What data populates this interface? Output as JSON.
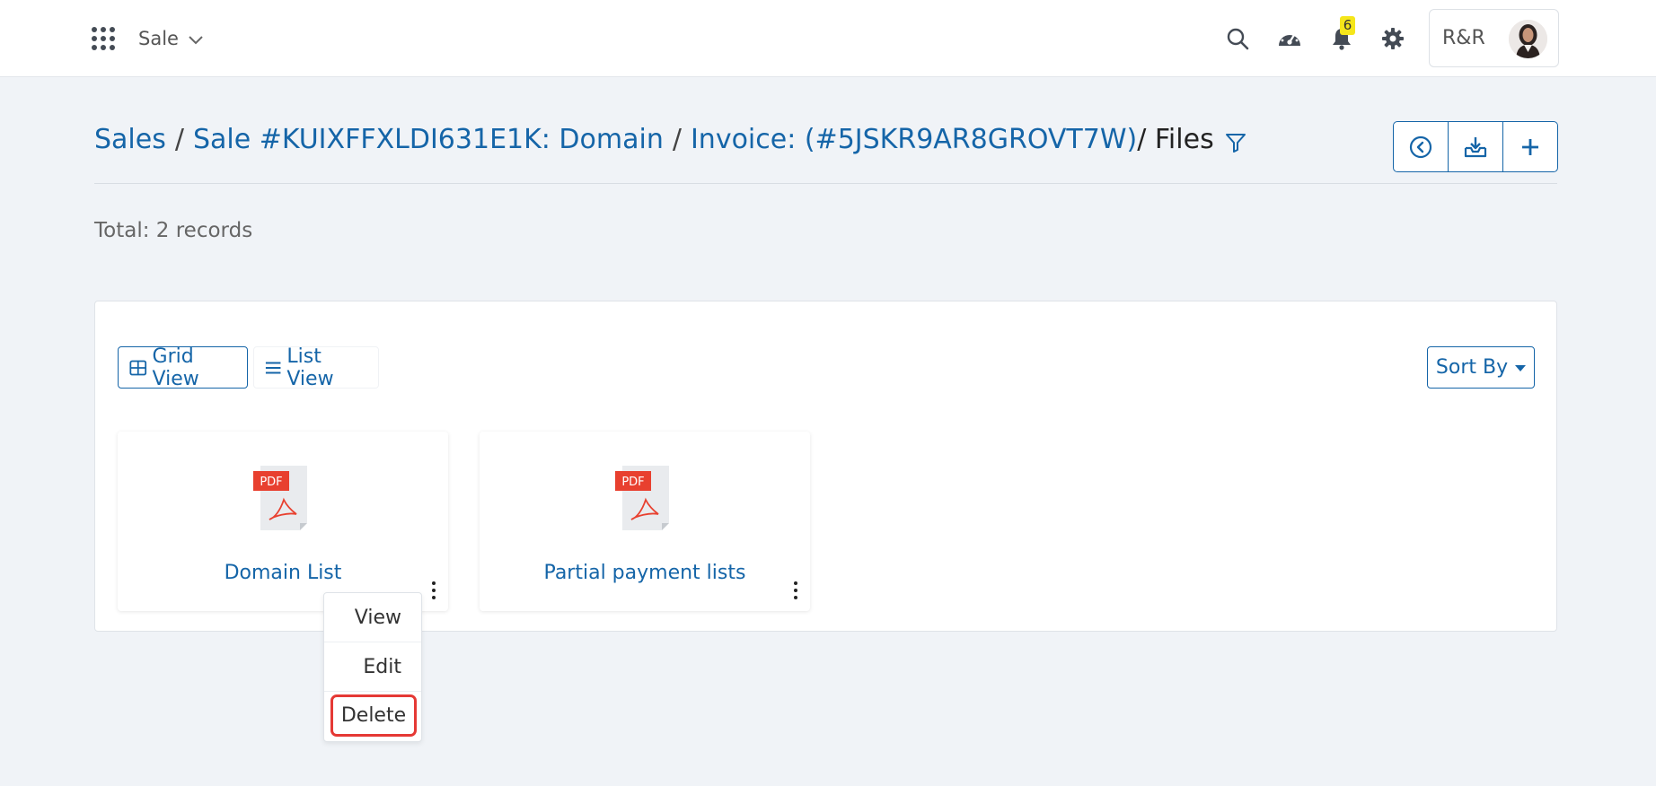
{
  "topbar": {
    "module": "Sale",
    "notification_count": "6",
    "user_name": "R&R",
    "icons": [
      "apps-grid-icon",
      "search-icon",
      "dashboard-gauge-icon",
      "bell-icon",
      "gear-icon",
      "chevron-down-icon"
    ]
  },
  "breadcrumb": {
    "sales": "Sales",
    "sep": "/",
    "sale": "Sale #KUIXFFXLDI631E1K: Domain",
    "invoice": "Invoice: (#5JSKR9AR8GROVT7W)",
    "current": "/ Files"
  },
  "actions": {
    "icons": [
      "back-circle-icon",
      "download-tray-icon",
      "plus-icon"
    ]
  },
  "summary": {
    "total": "Total: 2 records"
  },
  "toolbar": {
    "grid_view": "Grid View",
    "list_view": "List View",
    "sort_by": "Sort By"
  },
  "files": [
    {
      "name": "Domain List",
      "type_label": "PDF"
    },
    {
      "name": "Partial payment lists",
      "type_label": "PDF"
    }
  ],
  "context_menu": {
    "view": "View",
    "edit": "Edit",
    "delete": "Delete"
  },
  "colors": {
    "accent": "#1565a8",
    "background": "#f0f3f7",
    "badge": "#f5e61a",
    "highlight": "#e53935",
    "pdf_tag": "#e8402f"
  }
}
